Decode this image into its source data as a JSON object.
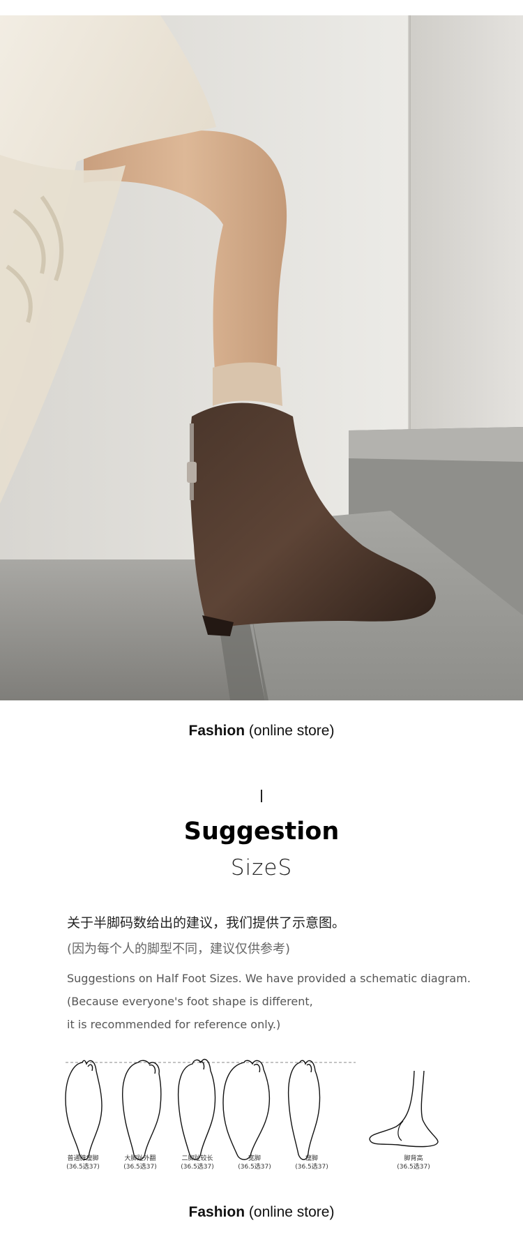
{
  "hero": {
    "icon": "boot-photo"
  },
  "brand": {
    "bold": "Fashion",
    "sub": "(online store)"
  },
  "heading": {
    "mark": "I",
    "title": "Suggestion",
    "subtitle": "SizeS"
  },
  "text": {
    "cn_line1": "关于半脚码数给出的建议，我们提供了示意图。",
    "cn_line2": "(因为每个人的脚型不同，建议仅供参考)",
    "en_line1": "Suggestions on Half Foot Sizes. We have provided a schematic diagram.",
    "en_line2": "(Because everyone's foot shape is different,",
    "en_line3": "it is recommended for reference only.)"
  },
  "feet": [
    {
      "name": "普通脖瘦脚",
      "size": "(36.5选37)"
    },
    {
      "name": "大脚趾外翻",
      "size": "(36.5选37)"
    },
    {
      "name": "二脚趾较长",
      "size": "(36.5选37)"
    },
    {
      "name": "宽脚",
      "size": "(36.5选37)"
    },
    {
      "name": "瘦脚",
      "size": "(36.5选37)"
    },
    {
      "name": "脚背高",
      "size": "(36.5选37)"
    }
  ],
  "colors": {
    "text": "#111111",
    "muted": "#666666",
    "boot": "#3b2a22"
  }
}
